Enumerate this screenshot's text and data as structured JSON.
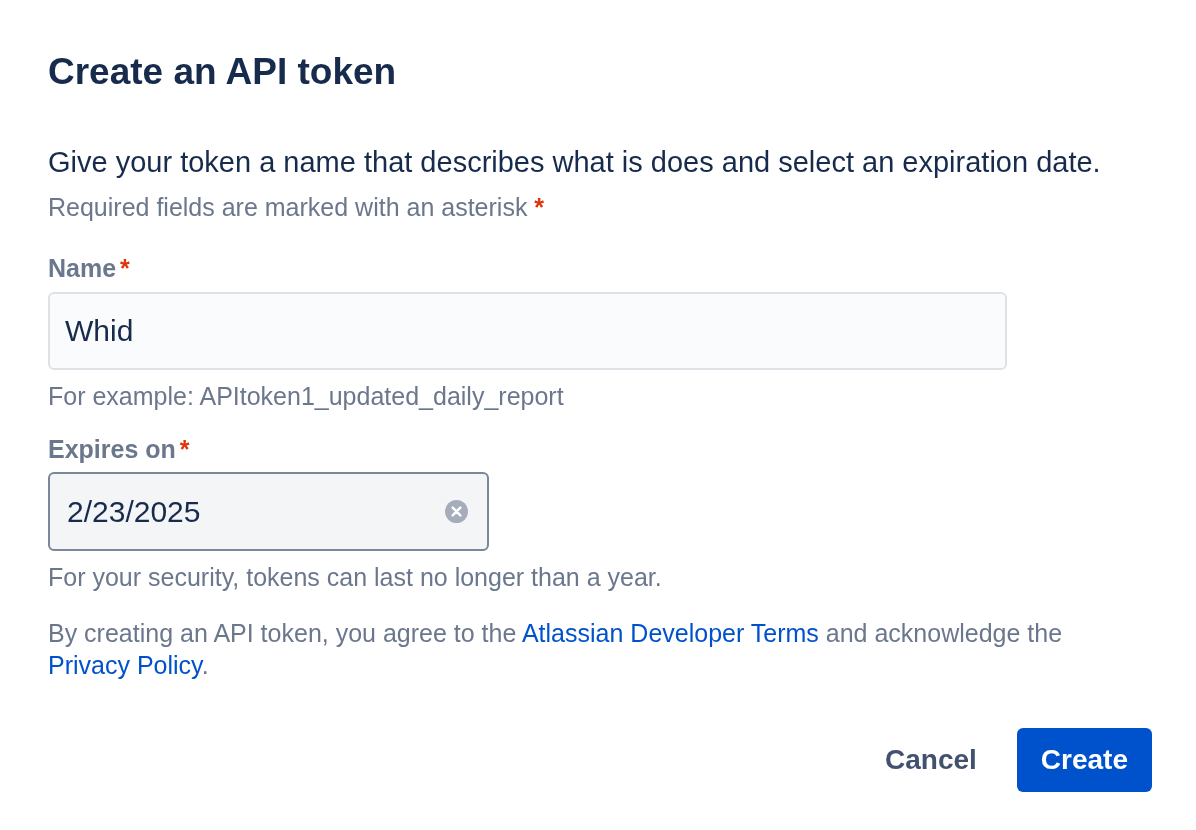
{
  "dialog": {
    "title": "Create an API token",
    "description": "Give your token a name that describes what is does and select an expiration date.",
    "required_note": {
      "text": "Required fields are marked with an asterisk",
      "marker": "*"
    },
    "fields": [
      {
        "kind": "text",
        "label": "Name",
        "required_marker": "*",
        "value": "Whid",
        "hovered": false,
        "clearable": false,
        "helper": "For example: APItoken1_updated_daily_report"
      },
      {
        "kind": "date",
        "label": "Expires on",
        "required_marker": "*",
        "value": "2/23/2025",
        "hovered": true,
        "clearable": true,
        "helper": "For your security, tokens can last no longer than a year."
      }
    ],
    "legal_text": [
      {
        "kind": "text",
        "text": "By creating an API token, you agree to the "
      },
      {
        "kind": "link",
        "text": "Atlassian Developer Terms"
      },
      {
        "kind": "text",
        "text": " and acknowledge the "
      },
      {
        "kind": "link",
        "text": "Privacy Policy"
      },
      {
        "kind": "text",
        "text": "."
      }
    ],
    "buttons": [
      {
        "kind": "subtle",
        "label": "Cancel"
      },
      {
        "kind": "primary",
        "label": "Create"
      }
    ]
  }
}
